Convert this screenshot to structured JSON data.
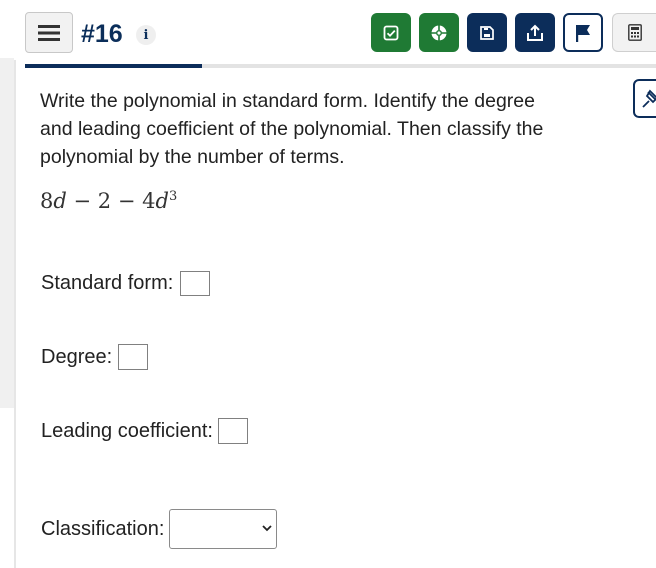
{
  "header": {
    "question_number": "#16",
    "info_glyph": "i",
    "menu_icon": "hamburger-icon",
    "toolbar": [
      {
        "name": "check-answer-button",
        "icon": "check-square-icon",
        "color": "#1f7a34"
      },
      {
        "name": "help-button",
        "icon": "lifebuoy-icon",
        "color": "#1f7a34"
      },
      {
        "name": "save-button",
        "icon": "save-icon",
        "color": "#0c2d5a"
      },
      {
        "name": "submit-button",
        "icon": "upload-icon",
        "color": "#0c2d5a"
      },
      {
        "name": "flag-button",
        "icon": "flag-icon",
        "color": "#0c2d5a"
      },
      {
        "name": "calculator-button",
        "icon": "calculator-icon",
        "color": "#f2f2f2"
      }
    ],
    "progress": 0.28
  },
  "question": {
    "instructions": "Write the polynomial in standard form. Identify the degree and leading coefficient of the polynomial. Then classify the polynomial by the number of terms.",
    "expression": {
      "t1_coef": "8",
      "t1_var": "d",
      "op1": " − ",
      "t2": "2",
      "op2": " − ",
      "t3_coef": "4",
      "t3_var": "d",
      "t3_exp": "3"
    }
  },
  "fields": {
    "standard_form_label": "Standard form:",
    "standard_form_value": "",
    "degree_label": "Degree:",
    "degree_value": "",
    "leading_coefficient_label": "Leading coefficient:",
    "leading_coefficient_value": "",
    "classification_label": "Classification:",
    "classification_selected": ""
  }
}
